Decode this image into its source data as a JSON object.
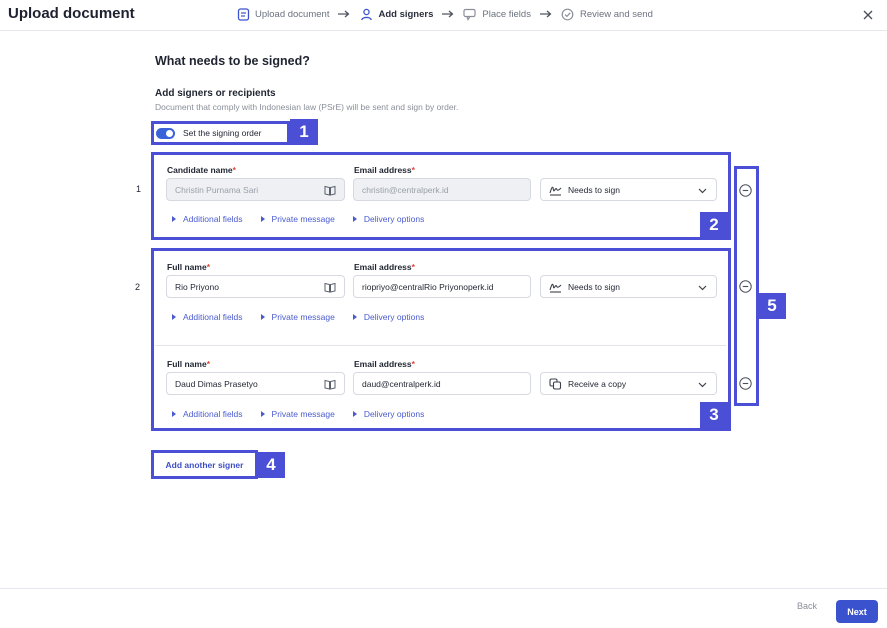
{
  "header": {
    "title": "Upload document",
    "steps": [
      {
        "label": "Upload document",
        "icon": "document-icon",
        "active": false
      },
      {
        "label": "Add signers",
        "icon": "user-icon",
        "active": true
      },
      {
        "label": "Place fields",
        "icon": "comment-icon",
        "active": false
      },
      {
        "label": "Review and send",
        "icon": "check-circle-icon",
        "active": false
      }
    ]
  },
  "main": {
    "title": "What needs to be signed?",
    "subtitle": "Add signers or recipients",
    "description": "Document that comply with Indonesian law (PSrE) will be sent and sign by order.",
    "signing_order_label": "Set the signing order",
    "signing_order_enabled": true,
    "add_signer_label": "Add another signer"
  },
  "annotations": [
    "1",
    "2",
    "3",
    "4",
    "5"
  ],
  "order_numbers": [
    "1",
    "2"
  ],
  "required_mark": "*",
  "link_labels": [
    "Additional fields",
    "Private message",
    "Delivery options"
  ],
  "signers": [
    {
      "name_label": "Candidate name",
      "name_value": "Christin Purnama Sari",
      "email_label": "Email address",
      "email_value": "christin@centralperk.id",
      "role": "Needs to sign",
      "role_icon": "signature-icon",
      "disabled": true
    },
    {
      "name_label": "Full name",
      "name_value": "Rio Priyono",
      "email_label": "Email address",
      "email_value": "riopriyo@centralRio Priyonoperk.id",
      "role": "Needs to sign",
      "role_icon": "signature-icon",
      "disabled": false
    },
    {
      "name_label": "Full name",
      "name_value": "Daud Dimas Prasetyo",
      "email_label": "Email address",
      "email_value": "daud@centralperk.id",
      "role": "Receive a copy",
      "role_icon": "copy-icon",
      "disabled": false
    }
  ],
  "footer": {
    "back_label": "Back",
    "next_label": "Next"
  },
  "colors": {
    "accent": "#3b52cf",
    "annotation": "#4a4fd6",
    "link": "#4a5bd0",
    "required": "#e0443a"
  }
}
